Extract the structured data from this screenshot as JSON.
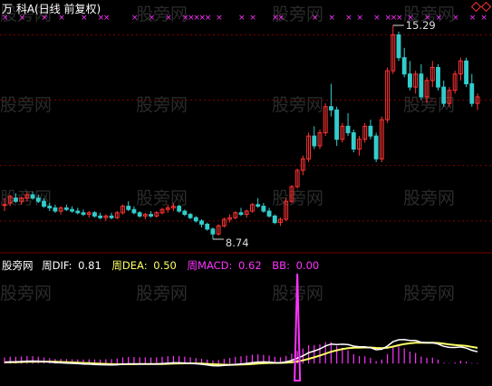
{
  "header": {
    "title": "万 科A(日线 前复权)"
  },
  "watermark_text": "股旁网",
  "main_chart": {
    "grid_levels": [
      15.0,
      13.0,
      11.0,
      9.3
    ],
    "high_label": "15.29",
    "low_label": "8.74",
    "candles": [
      [
        9.8,
        10.0,
        9.6,
        9.8
      ],
      [
        9.85,
        10.1,
        9.75,
        10.05
      ],
      [
        10.0,
        10.15,
        9.85,
        9.9
      ],
      [
        9.9,
        10.05,
        9.8,
        10.0
      ],
      [
        10.0,
        10.2,
        9.9,
        10.1
      ],
      [
        10.1,
        10.2,
        9.95,
        10.0
      ],
      [
        10.0,
        10.1,
        9.85,
        9.9
      ],
      [
        9.9,
        10.0,
        9.7,
        9.75
      ],
      [
        9.75,
        9.85,
        9.6,
        9.7
      ],
      [
        9.7,
        9.8,
        9.55,
        9.6
      ],
      [
        9.6,
        9.75,
        9.5,
        9.7
      ],
      [
        9.7,
        9.8,
        9.6,
        9.65
      ],
      [
        9.65,
        9.75,
        9.55,
        9.6
      ],
      [
        9.6,
        9.7,
        9.5,
        9.55
      ],
      [
        9.55,
        9.65,
        9.45,
        9.5
      ],
      [
        9.5,
        9.6,
        9.4,
        9.55
      ],
      [
        9.55,
        9.6,
        9.4,
        9.45
      ],
      [
        9.45,
        9.55,
        9.35,
        9.4
      ],
      [
        9.4,
        9.5,
        9.3,
        9.45
      ],
      [
        9.45,
        9.55,
        9.35,
        9.4
      ],
      [
        9.4,
        9.6,
        9.35,
        9.55
      ],
      [
        9.55,
        9.8,
        9.5,
        9.75
      ],
      [
        9.75,
        9.9,
        9.6,
        9.65
      ],
      [
        9.65,
        9.75,
        9.5,
        9.55
      ],
      [
        9.55,
        9.6,
        9.4,
        9.45
      ],
      [
        9.45,
        9.55,
        9.35,
        9.5
      ],
      [
        9.5,
        9.6,
        9.4,
        9.45
      ],
      [
        9.45,
        9.6,
        9.4,
        9.55
      ],
      [
        9.55,
        9.7,
        9.5,
        9.65
      ],
      [
        9.65,
        9.8,
        9.55,
        9.7
      ],
      [
        9.7,
        9.85,
        9.6,
        9.75
      ],
      [
        9.75,
        9.8,
        9.55,
        9.6
      ],
      [
        9.6,
        9.65,
        9.45,
        9.5
      ],
      [
        9.5,
        9.55,
        9.35,
        9.4
      ],
      [
        9.4,
        9.45,
        9.25,
        9.3
      ],
      [
        9.3,
        9.35,
        9.1,
        9.2
      ],
      [
        9.2,
        9.25,
        9.0,
        9.05
      ],
      [
        9.05,
        9.1,
        8.74,
        8.9
      ],
      [
        8.9,
        9.2,
        8.85,
        9.15
      ],
      [
        9.15,
        9.4,
        9.1,
        9.35
      ],
      [
        9.35,
        9.5,
        9.25,
        9.4
      ],
      [
        9.4,
        9.6,
        9.35,
        9.55
      ],
      [
        9.55,
        9.7,
        9.45,
        9.5
      ],
      [
        9.5,
        9.65,
        9.4,
        9.6
      ],
      [
        9.6,
        9.85,
        9.55,
        9.8
      ],
      [
        9.8,
        10.0,
        9.7,
        9.75
      ],
      [
        9.75,
        9.85,
        9.55,
        9.6
      ],
      [
        9.6,
        9.7,
        9.4,
        9.45
      ],
      [
        9.45,
        9.5,
        9.2,
        9.25
      ],
      [
        9.25,
        9.4,
        9.15,
        9.35
      ],
      [
        9.35,
        10.0,
        9.3,
        9.9
      ],
      [
        9.9,
        10.4,
        9.85,
        10.35
      ],
      [
        10.35,
        10.9,
        10.3,
        10.85
      ],
      [
        10.85,
        11.3,
        10.7,
        11.2
      ],
      [
        11.2,
        12.0,
        11.1,
        11.9
      ],
      [
        11.9,
        12.2,
        11.5,
        11.6
      ],
      [
        11.6,
        12.1,
        11.5,
        12.0
      ],
      [
        12.0,
        12.9,
        11.9,
        12.8
      ],
      [
        12.8,
        13.5,
        12.5,
        12.7
      ],
      [
        12.7,
        12.8,
        11.6,
        11.8
      ],
      [
        11.8,
        12.3,
        11.7,
        12.2
      ],
      [
        12.2,
        12.6,
        11.9,
        12.0
      ],
      [
        12.0,
        12.1,
        11.4,
        11.5
      ],
      [
        11.5,
        11.9,
        11.3,
        11.8
      ],
      [
        11.8,
        12.3,
        11.7,
        12.2
      ],
      [
        12.2,
        12.4,
        11.8,
        11.9
      ],
      [
        11.9,
        12.0,
        11.1,
        11.2
      ],
      [
        11.2,
        12.5,
        11.1,
        12.4
      ],
      [
        12.4,
        14.0,
        12.3,
        13.9
      ],
      [
        13.9,
        15.29,
        13.8,
        15.0
      ],
      [
        15.0,
        15.1,
        14.2,
        14.3
      ],
      [
        14.3,
        14.6,
        13.7,
        13.8
      ],
      [
        13.8,
        14.2,
        13.3,
        13.4
      ],
      [
        13.4,
        13.9,
        13.2,
        13.8
      ],
      [
        13.8,
        14.1,
        13.0,
        13.1
      ],
      [
        13.1,
        13.7,
        12.9,
        13.6
      ],
      [
        13.6,
        14.2,
        13.4,
        14.0
      ],
      [
        14.0,
        14.1,
        13.3,
        13.4
      ],
      [
        13.4,
        13.6,
        12.8,
        12.9
      ],
      [
        12.9,
        13.4,
        12.8,
        13.3
      ],
      [
        13.3,
        13.9,
        13.2,
        13.8
      ],
      [
        13.8,
        14.3,
        13.6,
        14.2
      ],
      [
        14.2,
        14.3,
        13.4,
        13.5
      ],
      [
        13.5,
        13.8,
        12.8,
        12.9
      ],
      [
        12.9,
        13.2,
        12.7,
        13.1
      ]
    ]
  },
  "signal_row": {
    "color": "#ff33ff",
    "glyph": "×",
    "columns": [
      0,
      3,
      7,
      10,
      14,
      17,
      18,
      23,
      26,
      29,
      32,
      33,
      34,
      35,
      36,
      38,
      42,
      44,
      48,
      49,
      55,
      58,
      61,
      63,
      66,
      68,
      69,
      70,
      72,
      75,
      77,
      80,
      83,
      85
    ]
  },
  "macd_panel": {
    "legend": {
      "source": "股旁网",
      "dif_label": "周DIF:",
      "dif_value": "0.81",
      "dea_label": "周DEA:",
      "dea_value": "0.50",
      "macd_label": "周MACD:",
      "macd_value": "0.62",
      "bb_label": "BB:",
      "bb_value": "0.00"
    },
    "colors": {
      "dif": "#ffffff",
      "dea": "#ffff66",
      "macd_pos": "#ff33ff",
      "macd_neg": "#ff66ff",
      "bb": "#ff33ff"
    },
    "ylim": [
      -0.7,
      3.7
    ]
  },
  "colors": {
    "up": "#ff3333",
    "down": "#33cccc",
    "grid": "#7a0000",
    "axis_text": "#dddddd",
    "header": "#ffffff",
    "nav": "#ff3333"
  }
}
